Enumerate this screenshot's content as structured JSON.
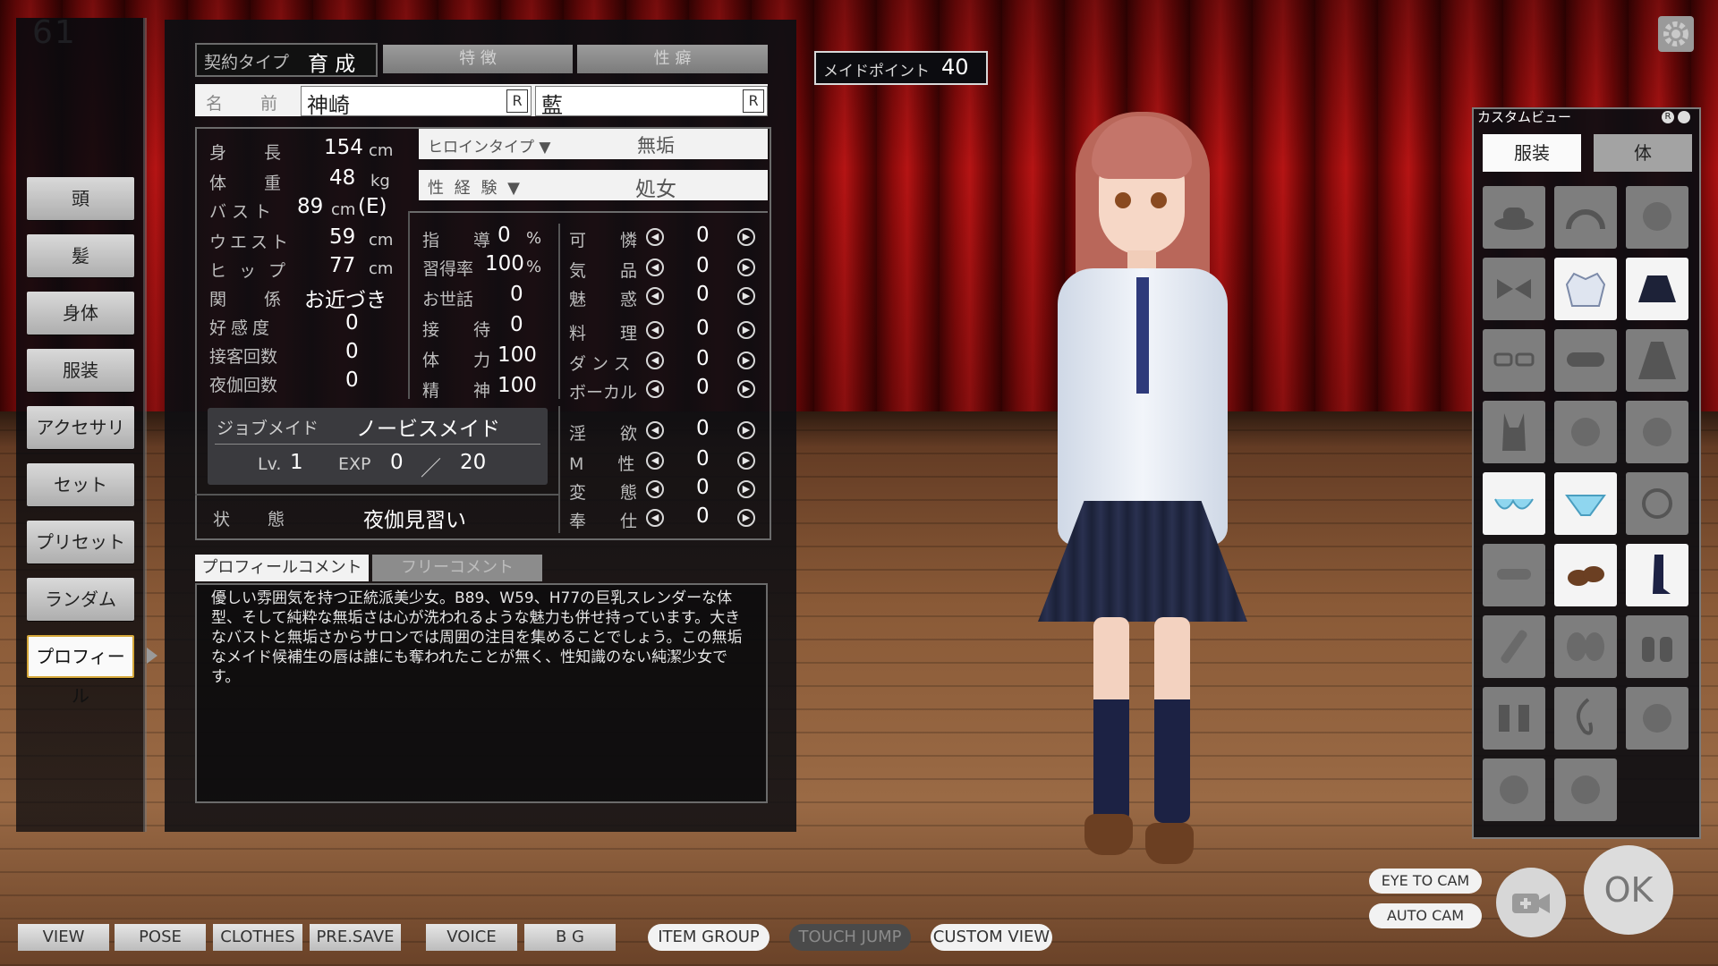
{
  "counter": "61",
  "left_menu": {
    "items": [
      {
        "label": "頭"
      },
      {
        "label": "髪"
      },
      {
        "label": "身体"
      },
      {
        "label": "服装"
      },
      {
        "label": "アクセサリ"
      },
      {
        "label": "セット"
      },
      {
        "label": "プリセット"
      },
      {
        "label": "ランダム"
      },
      {
        "label": "プロフィール"
      }
    ],
    "active_index": 8
  },
  "profile": {
    "contract": {
      "label": "契約タイプ",
      "value": "育 成"
    },
    "tabs": {
      "feature": "特 徴",
      "habit": "性 癖"
    },
    "name": {
      "label": "名 前",
      "family": "神崎",
      "given": "藍",
      "random": "R"
    },
    "body": {
      "height": {
        "label": "身 長",
        "value": "154",
        "unit": "cm"
      },
      "weight": {
        "label": "体 重",
        "value": "48",
        "unit": "kg"
      },
      "bust": {
        "label": "バスト",
        "value": "89",
        "unit": "cm",
        "cup": "(E)"
      },
      "waist": {
        "label": "ウエスト",
        "value": "59",
        "unit": "cm"
      },
      "hip": {
        "label": "ヒップ",
        "value": "77",
        "unit": "cm"
      },
      "relation": {
        "label": "関 係",
        "value": "お近づき"
      },
      "affection": {
        "label": "好感度",
        "value": "0"
      },
      "service_count": {
        "label": "接客回数",
        "value": "0"
      },
      "night_count": {
        "label": "夜伽回数",
        "value": "0"
      }
    },
    "heroine_type": {
      "label": "ヒロインタイプ ▼",
      "value": "無垢"
    },
    "experience": {
      "label": "性 経 験 ▼",
      "value": "処女"
    },
    "guidance": {
      "label": "指 導",
      "value": "0",
      "unit": "%"
    },
    "learning": {
      "label": "習得率",
      "value": "100",
      "unit": "%"
    },
    "care": {
      "label": "お世話",
      "value": "0"
    },
    "hospitality": {
      "label": "接 待",
      "value": "0"
    },
    "stamina": {
      "label": "体 力",
      "value": "100"
    },
    "mind": {
      "label": "精 神",
      "value": "100"
    },
    "params_a": [
      {
        "label": "可 憐",
        "value": "0"
      },
      {
        "label": "気 品",
        "value": "0"
      },
      {
        "label": "魅 惑",
        "value": "0"
      },
      {
        "label": "料 理",
        "value": "0"
      },
      {
        "label": "ダンス",
        "value": "0"
      },
      {
        "label": "ボーカル",
        "value": "0"
      }
    ],
    "params_b": [
      {
        "label": "淫 欲",
        "value": "0"
      },
      {
        "label": "M 性",
        "value": "0"
      },
      {
        "label": "変 態",
        "value": "0"
      },
      {
        "label": "奉 仕",
        "value": "0"
      }
    ],
    "job": {
      "label": "ジョブメイド",
      "value": "ノービスメイド",
      "lv_label": "Lv.",
      "lv": "1",
      "exp_label": "EXP",
      "exp": "0",
      "slash": "／",
      "exp_max": "20"
    },
    "status": {
      "label": "状 態",
      "value": "夜伽見習い"
    },
    "comment_tabs": {
      "profile": "プロフィールコメント",
      "free": "フリーコメント"
    },
    "comment": "優しい雰囲気を持つ正統派美少女。B89、W59、H77の巨乳スレンダーな体型、そして純粋な無垢さは心が洗われるような魅力も併せ持っています。大きなバストと無垢さからサロンでは周囲の注目を集めることでしょう。この無垢なメイド候補生の唇は誰にも奪われたことが無く、性知識のない純潔少女です。"
  },
  "maid_point": {
    "label": "メイドポイント",
    "value": "40"
  },
  "custom_view": {
    "title": "カスタムビュー",
    "tabs": {
      "clothes": "服装",
      "body": "体"
    },
    "active_tab": "clothes",
    "slots": [
      {
        "icon": "hat-icon",
        "on": false
      },
      {
        "icon": "headband-icon",
        "on": false
      },
      {
        "icon": "head-accessory-icon",
        "on": false
      },
      {
        "icon": "bow-icon",
        "on": false
      },
      {
        "icon": "blazer-icon",
        "on": true
      },
      {
        "icon": "skirt-icon",
        "on": true
      },
      {
        "icon": "glasses-icon",
        "on": false
      },
      {
        "icon": "eye-mask-icon",
        "on": false
      },
      {
        "icon": "dress-icon",
        "on": false
      },
      {
        "icon": "swimsuit-icon",
        "on": false
      },
      {
        "icon": "face-icon",
        "on": false
      },
      {
        "icon": "ear-accessory-icon",
        "on": false
      },
      {
        "icon": "bra-icon",
        "on": true
      },
      {
        "icon": "panties-icon",
        "on": true
      },
      {
        "icon": "necklace-icon",
        "on": false
      },
      {
        "icon": "collar-icon",
        "on": false
      },
      {
        "icon": "shoes-icon",
        "on": true
      },
      {
        "icon": "socks-icon",
        "on": true
      },
      {
        "icon": "arm-accessory-icon",
        "on": false
      },
      {
        "icon": "wings-icon",
        "on": false
      },
      {
        "icon": "gloves-icon",
        "on": false
      },
      {
        "icon": "leg-accessory-icon",
        "on": false
      },
      {
        "icon": "tail-icon",
        "on": false
      },
      {
        "icon": "back-accessory-icon",
        "on": false
      },
      {
        "icon": "cheek-accessory-icon",
        "on": false
      },
      {
        "icon": "mouth-accessory-icon",
        "on": false
      }
    ]
  },
  "toolbar": {
    "view": "VIEW",
    "pose": "POSE",
    "clothes": "CLOTHES",
    "presave": "PRE.SAVE",
    "voice": "VOICE",
    "bg": "B G",
    "item_group": "ITEM GROUP",
    "touch_jump": "TOUCH JUMP",
    "custom_view": "CUSTOM VIEW",
    "eye_to_cam": "EYE TO CAM",
    "auto_cam": "AUTO CAM",
    "ok": "OK"
  }
}
